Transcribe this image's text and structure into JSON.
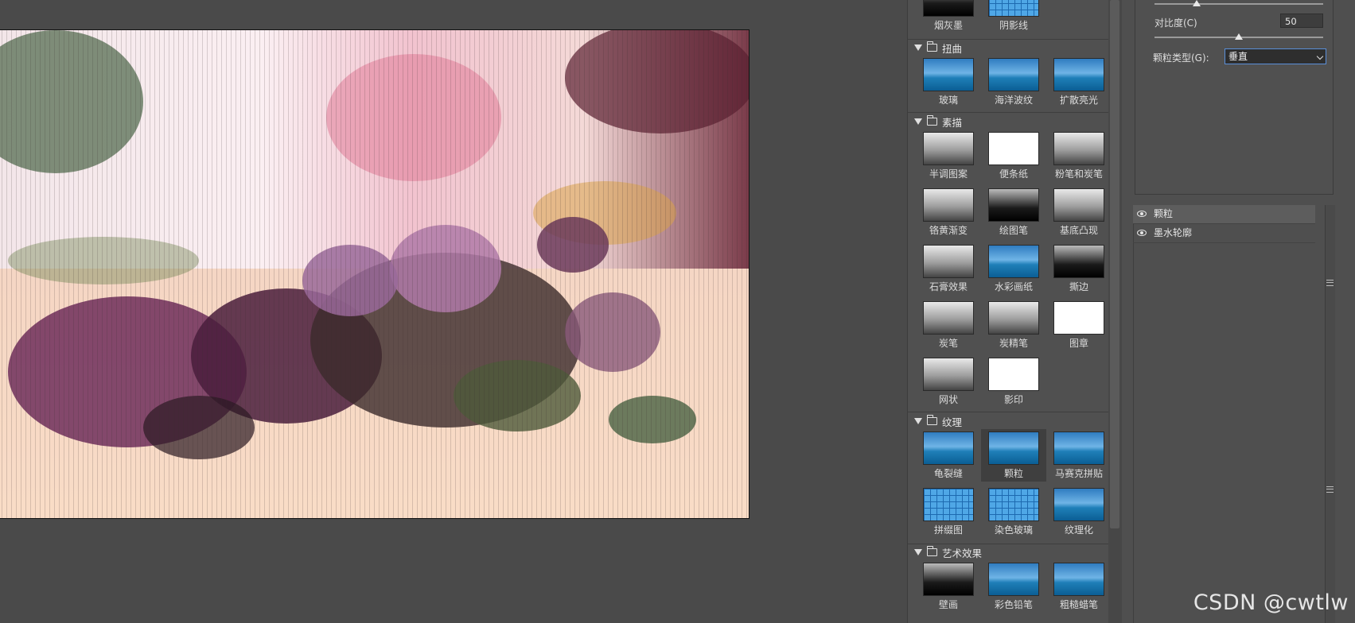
{
  "gallery": {
    "sections": [
      {
        "title": "",
        "items": [
          {
            "label": "烟灰墨",
            "thumb": "t-dark"
          },
          {
            "label": "阴影线",
            "thumb": "t-grid"
          }
        ]
      },
      {
        "title": "扭曲",
        "items": [
          {
            "label": "玻璃",
            "thumb": "t-sail"
          },
          {
            "label": "海洋波纹",
            "thumb": "t-sail"
          },
          {
            "label": "扩散亮光",
            "thumb": "t-sail"
          }
        ]
      },
      {
        "title": "素描",
        "items": [
          {
            "label": "半调图案",
            "thumb": "t-gray"
          },
          {
            "label": "便条纸",
            "thumb": "t-bw"
          },
          {
            "label": "粉笔和炭笔",
            "thumb": "t-gray"
          },
          {
            "label": "铬黄渐变",
            "thumb": "t-gray"
          },
          {
            "label": "绘图笔",
            "thumb": "t-dark"
          },
          {
            "label": "基底凸现",
            "thumb": "t-gray"
          },
          {
            "label": "石膏效果",
            "thumb": "t-gray"
          },
          {
            "label": "水彩画纸",
            "thumb": "t-sail"
          },
          {
            "label": "撕边",
            "thumb": "t-dark"
          },
          {
            "label": "炭笔",
            "thumb": "t-gray"
          },
          {
            "label": "炭精笔",
            "thumb": "t-gray"
          },
          {
            "label": "图章",
            "thumb": "t-bw"
          },
          {
            "label": "网状",
            "thumb": "t-gray"
          },
          {
            "label": "影印",
            "thumb": "t-bw"
          }
        ]
      },
      {
        "title": "纹理",
        "items": [
          {
            "label": "龟裂缝",
            "thumb": "t-sail"
          },
          {
            "label": "颗粒",
            "thumb": "t-sail",
            "selected": true
          },
          {
            "label": "马赛克拼贴",
            "thumb": "t-sail"
          },
          {
            "label": "拼缀图",
            "thumb": "t-grid"
          },
          {
            "label": "染色玻璃",
            "thumb": "t-grid"
          },
          {
            "label": "纹理化",
            "thumb": "t-sail"
          }
        ]
      },
      {
        "title": "艺术效果",
        "items": [
          {
            "label": "壁画",
            "thumb": "t-dark"
          },
          {
            "label": "彩色铅笔",
            "thumb": "t-sail"
          },
          {
            "label": "粗糙蜡笔",
            "thumb": "t-sail"
          }
        ]
      }
    ]
  },
  "settings": {
    "contrast_label": "对比度(C)",
    "contrast_value": "50",
    "contrast_level": 0.5,
    "intensity_level": 0.25,
    "grain_type_label": "颗粒类型(G):",
    "grain_type_value": "垂直"
  },
  "layers": [
    {
      "name": "颗粒",
      "active": true
    },
    {
      "name": "墨水轮廓",
      "active": false
    }
  ],
  "watermark": "CSDN @cwtlw",
  "colors": {
    "accent": "#5a8fd9",
    "panel": "#505050",
    "background": "#4a4a4a"
  }
}
